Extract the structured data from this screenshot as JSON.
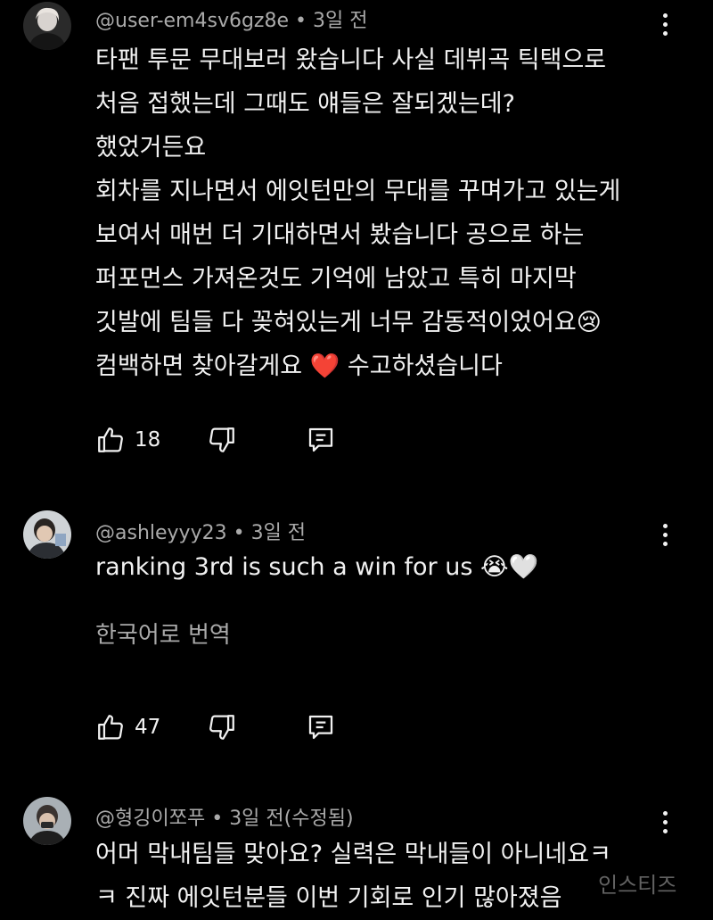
{
  "comments": [
    {
      "author": "@user-em4sv6gz8e",
      "time": "3일 전",
      "lines": [
        "타팬 투문 무대보러 왔습니다 사실 데뷔곡 틱택으로",
        "처음 접했는데 그때도 얘들은 잘되겠는데?",
        "했었거든요",
        "회차를 지나면서 에잇턴만의 무대를 꾸며가고 있는게",
        "보여서 매번 더 기대하면서 봤습니다 공으로 하는",
        "퍼포먼스 가져온것도 기억에 남았고 특히 마지막",
        "깃발에 팀들 다 꽂혀있는게 너무 감동적이었어요😢",
        "컴백하면 찾아갈게요 ❤️ 수고하셨습니다"
      ],
      "likes": "18"
    },
    {
      "author": "@ashleyyy23",
      "time": "3일 전",
      "lines": [
        "ranking 3rd is such a win for us 😭🤍"
      ],
      "translate": "한국어로 번역",
      "likes": "47"
    },
    {
      "author": "@형깅이쪼푸",
      "time": "3일 전(수정됨)",
      "lines": [
        "어머 막내팀들 맞아요? 실력은 막내들이 아니네요ㅋ",
        "ㅋ 진짜 에잇턴분들 이번 기회로 인기 많아졌음"
      ]
    }
  ],
  "watermark": "인스티즈",
  "icons": {
    "like": "thumbs-up-icon",
    "dislike": "thumbs-down-icon",
    "reply": "reply-icon",
    "more": "more-vert-icon"
  }
}
